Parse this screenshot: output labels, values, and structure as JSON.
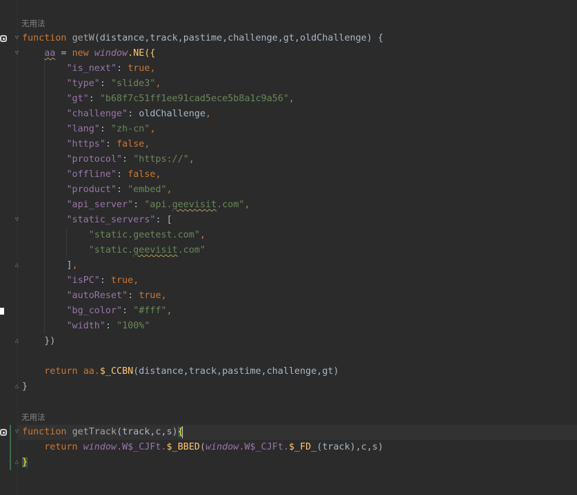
{
  "hints": {
    "block1": "无用法",
    "block2": "无用法"
  },
  "code": {
    "l1_kw": "function",
    "l1_name": "getW",
    "l1_params": "(distance,track,pastime,challenge,gt,oldChallenge) {",
    "l2_var": "aa",
    "l2_op": " = ",
    "l2_new": "new",
    "l2_window": "window",
    "l2_rest": ".NE({",
    "l3_key": "\"is_next\"",
    "l3_val": "true",
    "l4_key": "\"type\"",
    "l4_val": "\"slide3\"",
    "l5_key": "\"gt\"",
    "l5_val": "\"b68f7c51ff1ee91cad5ece5b8a1c9a56\"",
    "l6_key": "\"challenge\"",
    "l6_val": "oldChallenge",
    "l7_key": "\"lang\"",
    "l7_val": "\"zh-cn\"",
    "l8_key": "\"https\"",
    "l8_val": "false",
    "l9_key": "\"protocol\"",
    "l9_val": "\"https://\"",
    "l10_key": "\"offline\"",
    "l10_val": "false",
    "l11_key": "\"product\"",
    "l11_val": "\"embed\"",
    "l12_key": "\"api_server\"",
    "l12_val_a": "\"api.",
    "l12_val_b": "geevisit",
    "l12_val_c": ".com\"",
    "l13_key": "\"static_servers\"",
    "l13_rest": ": [",
    "l14_val": "\"static.geetest.com\"",
    "l15_val_a": "\"static.",
    "l15_val_b": "geevisit",
    "l15_val_c": ".com\"",
    "l16_close": "]",
    "l17_key": "\"isPC\"",
    "l17_val": "true",
    "l18_key": "\"autoReset\"",
    "l18_val": "true",
    "l19_key": "\"bg_color\"",
    "l19_val": "\"#fff\"",
    "l20_key": "\"width\"",
    "l20_val": "\"100%\"",
    "l21_close": "})",
    "l22_ret": "return",
    "l22_obj": "aa.",
    "l22_fn": "$_CCBN",
    "l22_args": "(distance,track,pastime,challenge,gt)",
    "l23_close": "}",
    "l24_kw": "function",
    "l24_name": "getTrack",
    "l24_params": "(track,c,s)",
    "l24_brace": "{",
    "l25_ret": "return",
    "l25_win1": "window",
    "l25_p1": ".W$_CJFt.",
    "l25_fn1": "$_BBED",
    "l25_p2": "(",
    "l25_win2": "window",
    "l25_p3": ".W$_CJFt.",
    "l25_fn2": "$_FD_",
    "l25_p4": "(track),c,s)",
    "l26_close": "}"
  },
  "colors": {
    "background": "#2b2b2b",
    "keyword": "#cc7832",
    "string": "#6a8759",
    "property_key": "#9876aa",
    "function": "#ffc66d",
    "text": "#a9b7c6"
  }
}
